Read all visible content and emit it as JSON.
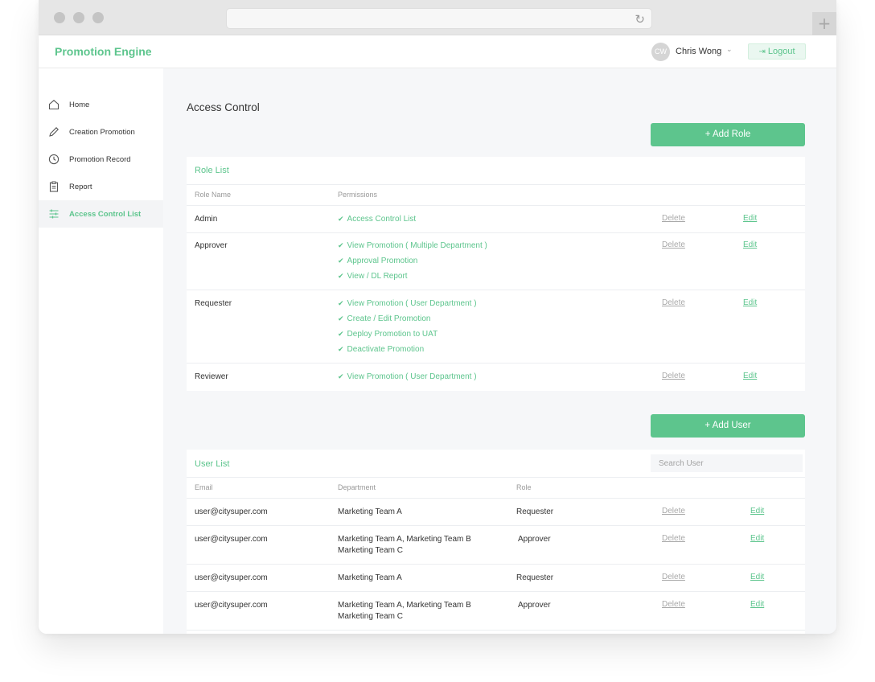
{
  "app": {
    "title": "Promotion Engine"
  },
  "user": {
    "initials": "CW",
    "name": "Chris Wong",
    "logout_label": "Logout"
  },
  "sidebar": {
    "items": [
      {
        "label": "Home",
        "icon": "home-icon"
      },
      {
        "label": "Creation Promotion",
        "icon": "pencil-icon"
      },
      {
        "label": "Promotion Record",
        "icon": "clock-icon"
      },
      {
        "label": "Report",
        "icon": "clipboard-icon"
      },
      {
        "label": "Access Control List",
        "icon": "sliders-icon",
        "active": true
      }
    ]
  },
  "page": {
    "title": "Access Control"
  },
  "roles": {
    "add_label": "+ Add Role",
    "title": "Role List",
    "headers": {
      "name": "Role Name",
      "permissions": "Permissions"
    },
    "rows": [
      {
        "name": "Admin",
        "permissions": [
          "Access Control List"
        ],
        "delete": "Delete",
        "edit": "Edit"
      },
      {
        "name": "Approver",
        "permissions": [
          "View Promotion ( Multiple Department )",
          "Approval Promotion",
          "View / DL Report"
        ],
        "delete": "Delete",
        "edit": "Edit"
      },
      {
        "name": "Requester",
        "permissions": [
          "View Promotion ( User Department )",
          "Create / Edit Promotion",
          "Deploy Promotion to UAT",
          "Deactivate Promotion"
        ],
        "delete": "Delete",
        "edit": "Edit"
      },
      {
        "name": "Reviewer",
        "permissions": [
          "View Promotion ( User Department )"
        ],
        "delete": "Delete",
        "edit": "Edit"
      }
    ]
  },
  "users": {
    "add_label": "+ Add User",
    "title": "User List",
    "search_placeholder": "Search User",
    "headers": {
      "email": "Email",
      "department": "Department",
      "role": "Role"
    },
    "rows": [
      {
        "email": "user@citysuper.com",
        "department": [
          "Marketing Team A"
        ],
        "role": "Requester",
        "delete": "Delete",
        "edit": "Edit"
      },
      {
        "email": "user@citysuper.com",
        "department": [
          "Marketing Team A, Marketing Team B",
          "Marketing Team C"
        ],
        "role": "Approver",
        "delete": "Delete",
        "edit": "Edit"
      },
      {
        "email": "user@citysuper.com",
        "department": [
          "Marketing Team A"
        ],
        "role": "Requester",
        "delete": "Delete",
        "edit": "Edit"
      },
      {
        "email": "user@citysuper.com",
        "department": [
          "Marketing Team A, Marketing Team B",
          "Marketing Team C"
        ],
        "role": "Approver",
        "delete": "Delete",
        "edit": "Edit"
      }
    ]
  },
  "colors": {
    "accent": "#5dc58d",
    "muted": "#a8a8a8"
  }
}
